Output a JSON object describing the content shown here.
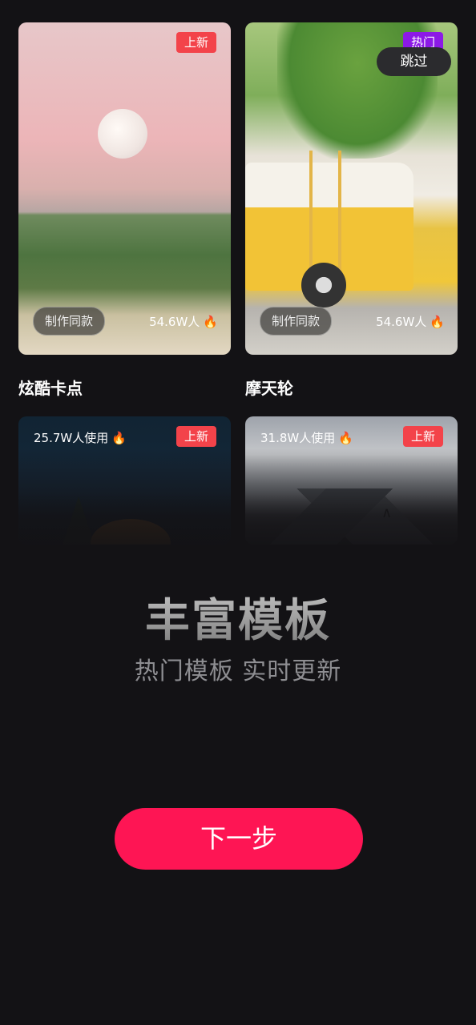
{
  "skip_label": "跳过",
  "cards": [
    {
      "title": "炫酷卡点",
      "badge": "上新",
      "make_label": "制作同款",
      "stat": "54.6W人"
    },
    {
      "title": "摩天轮",
      "badge": "热门",
      "make_label": "制作同款",
      "stat": "54.6W人"
    },
    {
      "badge": "上新",
      "stat": "25.7W人使用"
    },
    {
      "badge": "上新",
      "stat": "31.8W人使用"
    }
  ],
  "headline": "丰富模板",
  "subheadline": "热门模板 实时更新",
  "next_button": "下一步",
  "colors": {
    "accent": "#fe1554",
    "badge_new": "#f3434a",
    "badge_hot": "#8c19e6",
    "background": "#131215"
  }
}
